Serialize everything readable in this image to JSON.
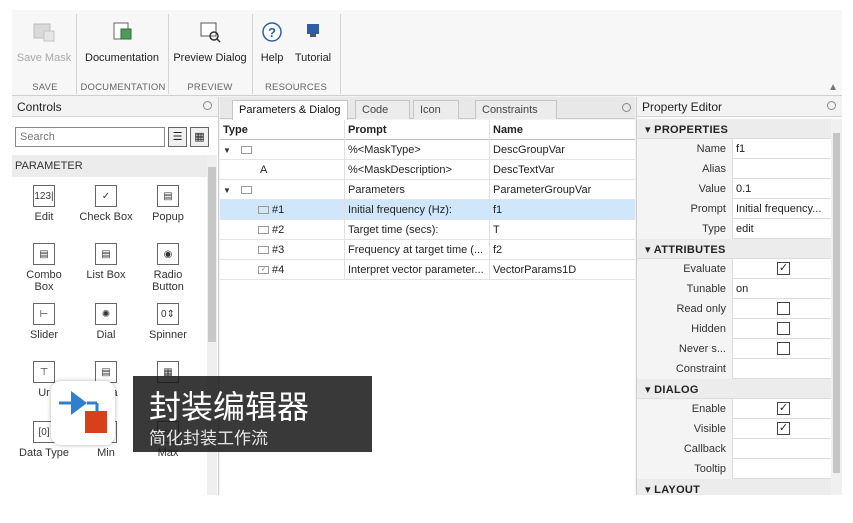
{
  "toolstrip": {
    "buttons": [
      {
        "label": "Save Mask",
        "icon": "save-mask-icon",
        "enabled": false
      },
      {
        "label": "Documentation",
        "icon": "documentation-icon",
        "enabled": true
      },
      {
        "label": "Preview Dialog",
        "icon": "preview-dialog-icon",
        "enabled": true
      },
      {
        "label": "Help",
        "icon": "help-icon",
        "enabled": true
      },
      {
        "label": "Tutorial",
        "icon": "tutorial-icon",
        "enabled": true
      }
    ],
    "sections": [
      "SAVE",
      "DOCUMENTATION",
      "PREVIEW",
      "RESOURCES"
    ]
  },
  "controls": {
    "title": "Controls",
    "search_placeholder": "Search",
    "category": "PARAMETER",
    "items": [
      {
        "label": "Edit",
        "icon": "123|"
      },
      {
        "label": "Check Box",
        "icon": "✓"
      },
      {
        "label": "Popup",
        "icon": "▤"
      },
      {
        "label": "Combo\nBox",
        "icon": "▤"
      },
      {
        "label": "List Box",
        "icon": "▤"
      },
      {
        "label": "Radio\nButton",
        "icon": "◉"
      },
      {
        "label": "Slider",
        "icon": "⊢"
      },
      {
        "label": "Dial",
        "icon": "✺"
      },
      {
        "label": "Spinner",
        "icon": "0⇕"
      },
      {
        "label": "Ur",
        "icon": "⊤"
      },
      {
        "label": "Area",
        "icon": "▤"
      },
      {
        "label": "",
        "icon": "▦"
      },
      {
        "label": "Data Type",
        "icon": "[0]"
      },
      {
        "label": "Min",
        "icon": "▭"
      },
      {
        "label": "Max",
        "icon": "▭"
      }
    ]
  },
  "tabs": [
    "Parameters & Dialog",
    "Code",
    "Icon",
    "Constraints"
  ],
  "table": {
    "headers": [
      "Type",
      "Prompt",
      "Name"
    ],
    "rows": [
      {
        "type": "",
        "prompt": "%<MaskType>",
        "name": "DescGroupVar",
        "kind": "group"
      },
      {
        "type": "A",
        "prompt": "%<MaskDescription>",
        "name": "DescTextVar",
        "kind": "text"
      },
      {
        "type": "",
        "prompt": "Parameters",
        "name": "ParameterGroupVar",
        "kind": "group"
      },
      {
        "type": "#1",
        "prompt": "Initial frequency (Hz):",
        "name": "f1",
        "kind": "edit",
        "selected": true
      },
      {
        "type": "#2",
        "prompt": "Target time (secs):",
        "name": "T",
        "kind": "edit"
      },
      {
        "type": "#3",
        "prompt": "Frequency at target time (...",
        "name": "f2",
        "kind": "edit"
      },
      {
        "type": "#4",
        "prompt": "Interpret vector parameter...",
        "name": "VectorParams1D",
        "kind": "check"
      }
    ]
  },
  "property_editor": {
    "title": "Property Editor",
    "sections": [
      {
        "title": "PROPERTIES",
        "rows": [
          {
            "name": "Name",
            "value": "f1"
          },
          {
            "name": "Alias",
            "value": ""
          },
          {
            "name": "Value",
            "value": "0.1"
          },
          {
            "name": "Prompt",
            "value": "Initial frequency..."
          },
          {
            "name": "Type",
            "value": "edit"
          }
        ]
      },
      {
        "title": "ATTRIBUTES",
        "rows": [
          {
            "name": "Evaluate",
            "check": true
          },
          {
            "name": "Tunable",
            "value": "on"
          },
          {
            "name": "Read only",
            "check": false
          },
          {
            "name": "Hidden",
            "check": false
          },
          {
            "name": "Never s...",
            "check": false
          },
          {
            "name": "Constraint",
            "value": ""
          }
        ]
      },
      {
        "title": "DIALOG",
        "rows": [
          {
            "name": "Enable",
            "check": true
          },
          {
            "name": "Visible",
            "check": true
          },
          {
            "name": "Callback",
            "value": ""
          },
          {
            "name": "Tooltip",
            "value": ""
          }
        ]
      },
      {
        "title": "LAYOUT",
        "rows": []
      }
    ]
  },
  "overlay": {
    "title": "封装编辑器",
    "subtitle": "简化封装工作流",
    "colors": {
      "accent_blue": "#2f7fd0",
      "accent_red": "#d8401c"
    }
  }
}
